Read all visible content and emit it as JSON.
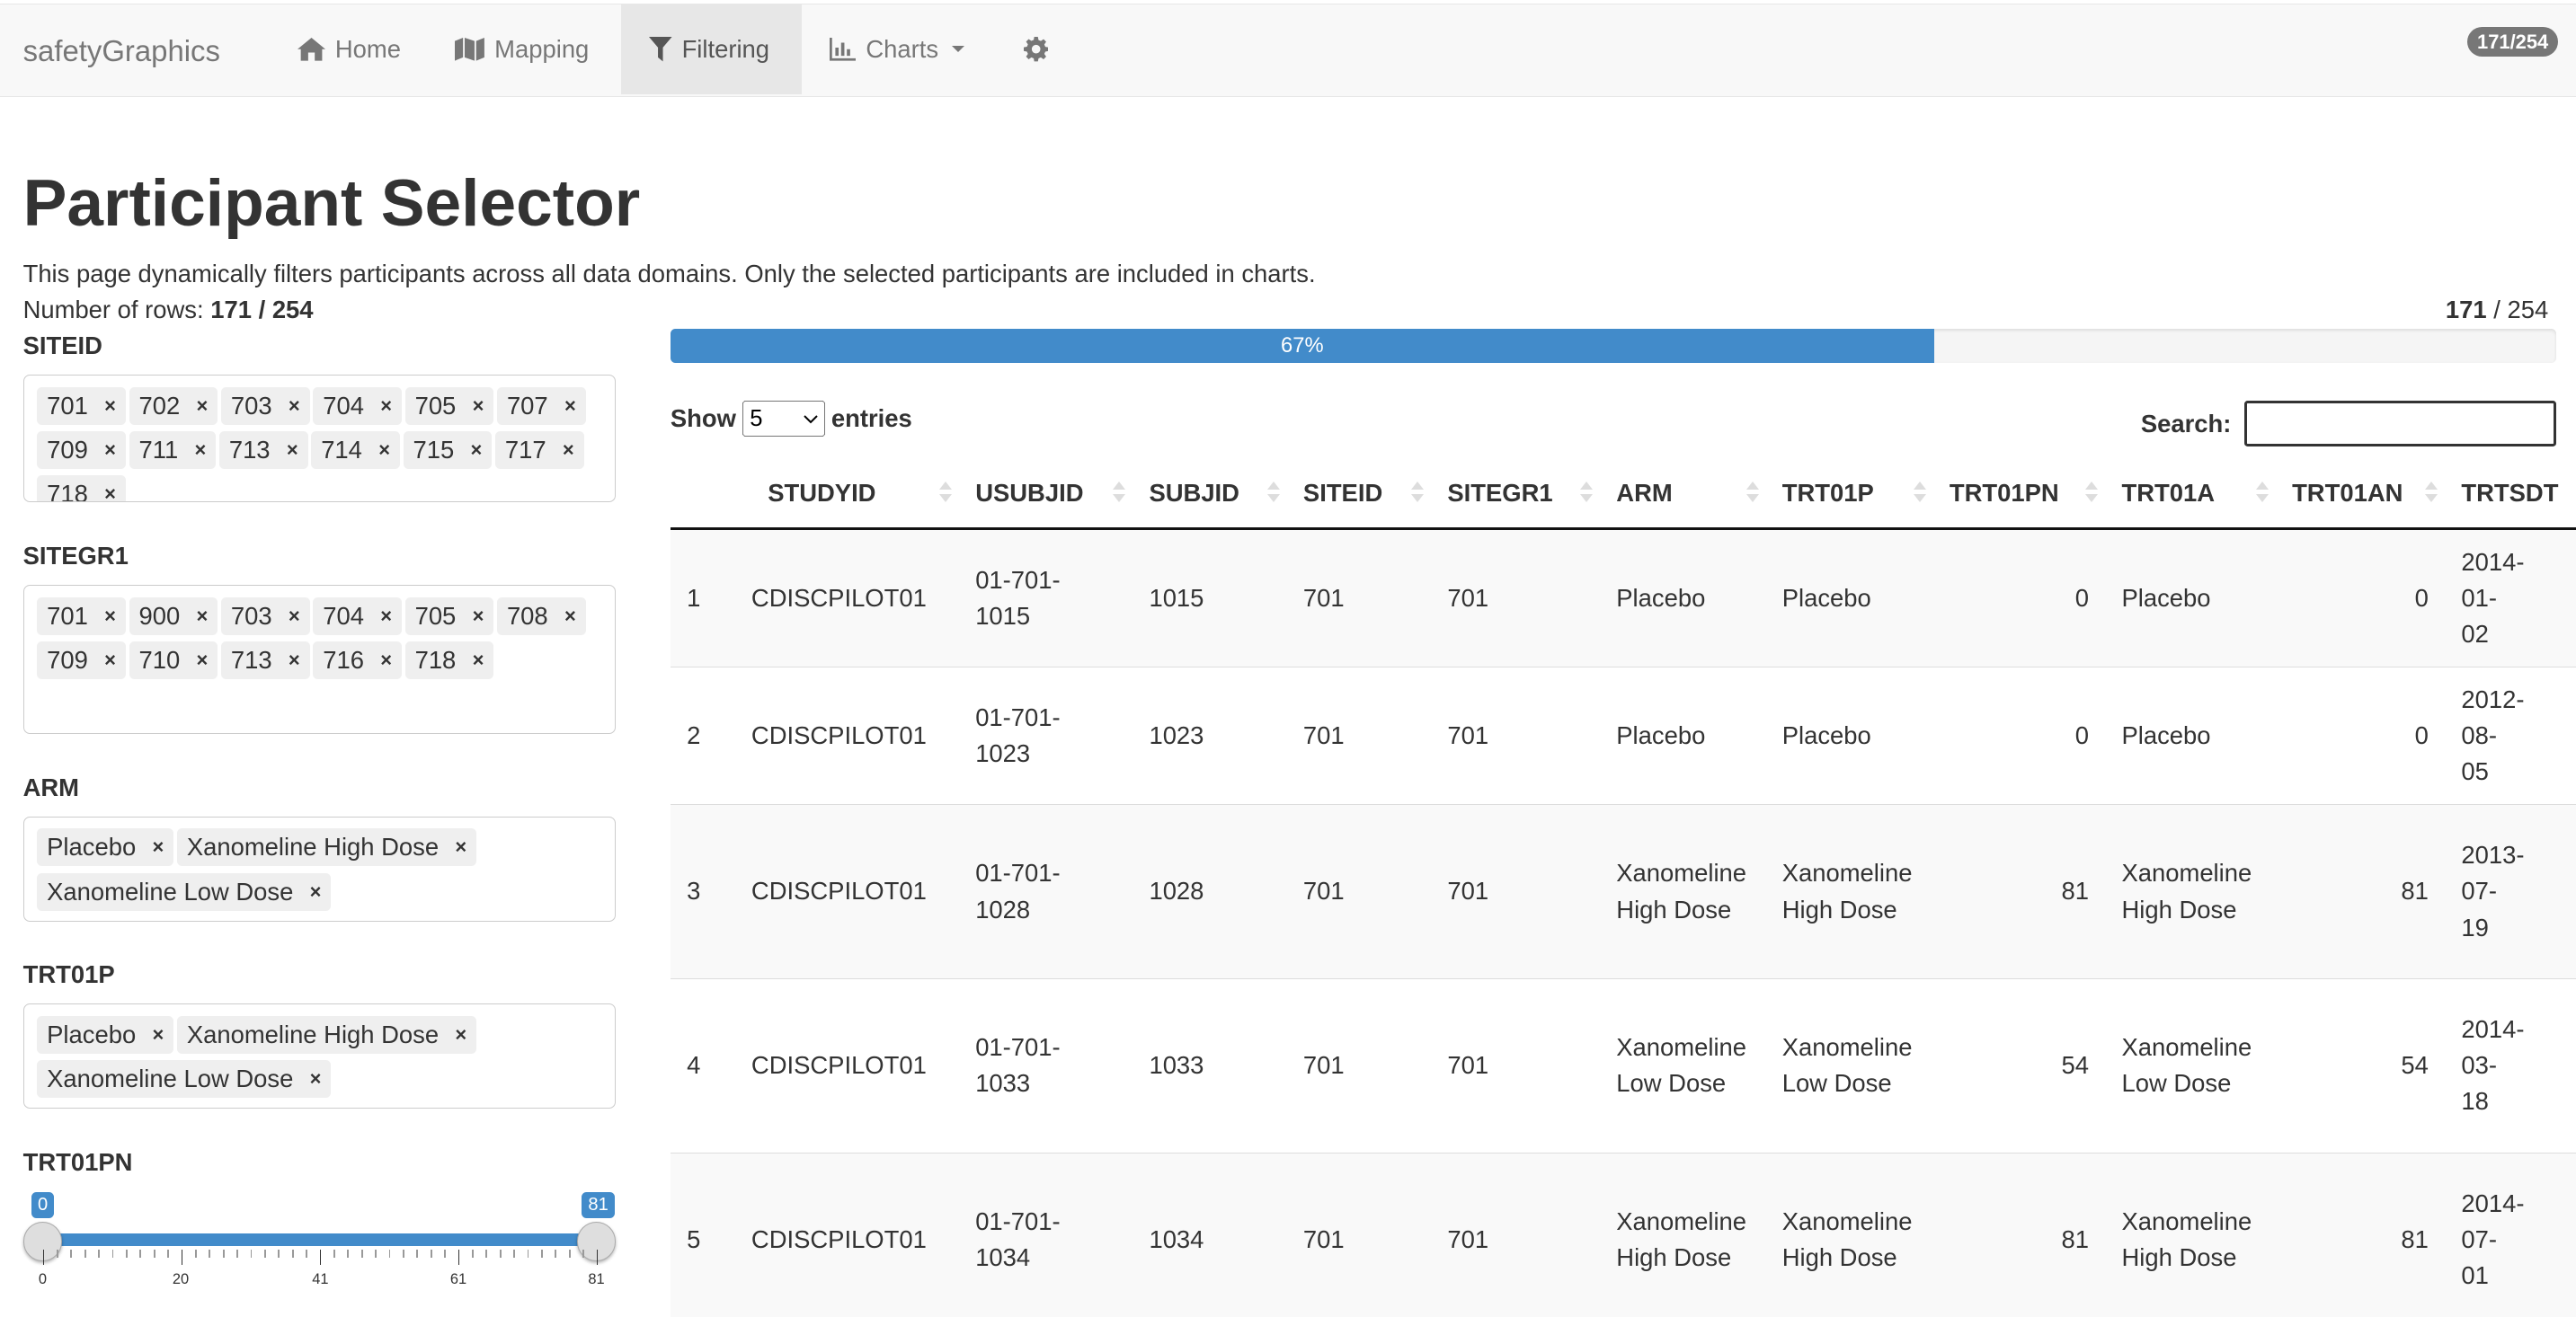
{
  "navbar": {
    "brand": "safetyGraphics",
    "items": [
      {
        "label": "Home",
        "icon": "home-icon"
      },
      {
        "label": "Mapping",
        "icon": "map-icon"
      },
      {
        "label": "Filtering",
        "icon": "filter-icon",
        "active": true
      },
      {
        "label": "Charts",
        "icon": "bar-chart-icon",
        "dropdown": true
      }
    ],
    "settings_icon": "gear-icon",
    "badge": "171/254"
  },
  "page": {
    "title": "Participant Selector",
    "description": "This page dynamically filters participants across all data domains. Only the selected participants are included in charts.",
    "rows_label": "Number of rows:",
    "rows_value": "171 / 254"
  },
  "filters": {
    "siteid": {
      "label": "SITEID",
      "chips": [
        "701",
        "702",
        "703",
        "704",
        "705",
        "707",
        "709",
        "711",
        "713",
        "714",
        "715",
        "717",
        "718"
      ]
    },
    "sitegr1": {
      "label": "SITEGR1",
      "chips": [
        "701",
        "900",
        "703",
        "704",
        "705",
        "708",
        "709",
        "710",
        "713",
        "716",
        "718"
      ]
    },
    "arm": {
      "label": "ARM",
      "chips": [
        "Placebo",
        "Xanomeline High Dose",
        "Xanomeline Low Dose"
      ]
    },
    "trt01p": {
      "label": "TRT01P",
      "chips": [
        "Placebo",
        "Xanomeline High Dose",
        "Xanomeline Low Dose"
      ]
    },
    "trt01pn": {
      "label": "TRT01PN",
      "min": 0,
      "max": 81,
      "low": "0",
      "high": "81",
      "tick_labels": [
        "0",
        "20",
        "41",
        "61",
        "81"
      ]
    }
  },
  "progress": {
    "selected": "171",
    "total": "/ 254",
    "percent_label": "67%",
    "fraction": 0.67
  },
  "table": {
    "show_label": "Show",
    "entries_label": "entries",
    "page_length": "5",
    "search_label": "Search:",
    "search_value": "",
    "columns": [
      "",
      "STUDYID",
      "USUBJID",
      "SUBJID",
      "SITEID",
      "SITEGR1",
      "ARM",
      "TRT01P",
      "TRT01PN",
      "TRT01A",
      "TRT01AN",
      "TRTSDT"
    ],
    "rows": [
      {
        "n": "1",
        "studyid": "CDISCPILOT01",
        "usubjid": [
          "01-701-",
          "1015"
        ],
        "subjid": "1015",
        "siteid": "701",
        "sitegr1": "701",
        "arm": [
          "Placebo"
        ],
        "trt01p": [
          "Placebo"
        ],
        "trt01pn": "0",
        "trt01a": [
          "Placebo"
        ],
        "trt01an": "0",
        "trtsdt": [
          "2014-01-",
          "02"
        ]
      },
      {
        "n": "2",
        "studyid": "CDISCPILOT01",
        "usubjid": [
          "01-701-",
          "1023"
        ],
        "subjid": "1023",
        "siteid": "701",
        "sitegr1": "701",
        "arm": [
          "Placebo"
        ],
        "trt01p": [
          "Placebo"
        ],
        "trt01pn": "0",
        "trt01a": [
          "Placebo"
        ],
        "trt01an": "0",
        "trtsdt": [
          "2012-08-",
          "05"
        ]
      },
      {
        "n": "3",
        "studyid": "CDISCPILOT01",
        "usubjid": [
          "01-701-",
          "1028"
        ],
        "subjid": "1028",
        "siteid": "701",
        "sitegr1": "701",
        "arm": [
          "Xanomeline",
          "High Dose"
        ],
        "trt01p": [
          "Xanomeline",
          "High Dose"
        ],
        "trt01pn": "81",
        "trt01a": [
          "Xanomeline",
          "High Dose"
        ],
        "trt01an": "81",
        "trtsdt": [
          "2013-07-",
          "19"
        ]
      },
      {
        "n": "4",
        "studyid": "CDISCPILOT01",
        "usubjid": [
          "01-701-",
          "1033"
        ],
        "subjid": "1033",
        "siteid": "701",
        "sitegr1": "701",
        "arm": [
          "Xanomeline",
          "Low Dose"
        ],
        "trt01p": [
          "Xanomeline",
          "Low Dose"
        ],
        "trt01pn": "54",
        "trt01a": [
          "Xanomeline",
          "Low Dose"
        ],
        "trt01an": "54",
        "trtsdt": [
          "2014-03-",
          "18"
        ]
      },
      {
        "n": "5",
        "studyid": "CDISCPILOT01",
        "usubjid": [
          "01-701-",
          "1034"
        ],
        "subjid": "1034",
        "siteid": "701",
        "sitegr1": "701",
        "arm": [
          "Xanomeline",
          "High Dose"
        ],
        "trt01p": [
          "Xanomeline",
          "High Dose"
        ],
        "trt01pn": "81",
        "trt01a": [
          "Xanomeline",
          "High Dose"
        ],
        "trt01an": "81",
        "trtsdt": [
          "2014-07-",
          "01"
        ]
      }
    ]
  }
}
